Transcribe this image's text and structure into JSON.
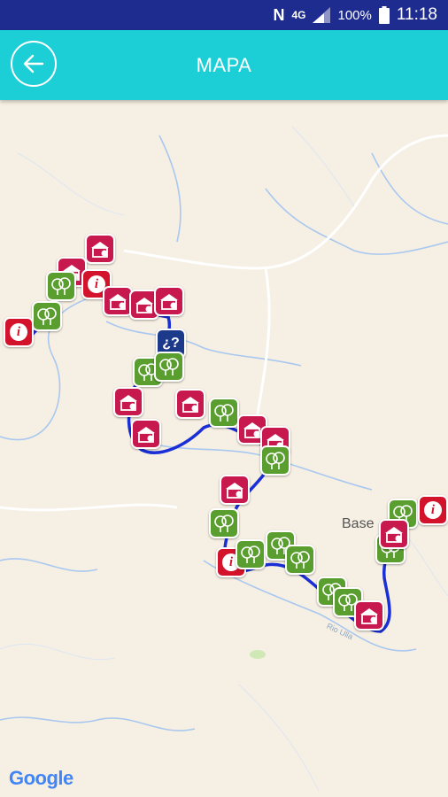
{
  "status_bar": {
    "network_label": "4G",
    "battery_percent": "100%",
    "time": "11:18"
  },
  "app_bar": {
    "title": "MAPA",
    "back_icon": "arrow-left-icon"
  },
  "map": {
    "place_label": "Base",
    "river_label": "Rio Ulla",
    "attribution": "Google",
    "markers": [
      {
        "type": "house",
        "icon": "house-icon"
      },
      {
        "type": "house",
        "icon": "house-icon"
      },
      {
        "type": "info",
        "icon": "info-icon"
      },
      {
        "type": "nature",
        "icon": "tree-icon"
      },
      {
        "type": "nature",
        "icon": "tree-icon"
      },
      {
        "type": "info",
        "icon": "info-icon"
      },
      {
        "type": "house",
        "icon": "house-icon"
      },
      {
        "type": "house",
        "icon": "house-icon"
      },
      {
        "type": "house",
        "icon": "house-icon"
      },
      {
        "type": "help",
        "icon": "question-icon"
      },
      {
        "type": "nature",
        "icon": "tree-icon"
      },
      {
        "type": "nature",
        "icon": "tree-icon"
      },
      {
        "type": "house",
        "icon": "house-icon"
      },
      {
        "type": "house",
        "icon": "house-icon"
      },
      {
        "type": "house",
        "icon": "house-icon"
      },
      {
        "type": "nature",
        "icon": "tree-icon"
      },
      {
        "type": "house",
        "icon": "house-icon"
      },
      {
        "type": "house",
        "icon": "house-icon"
      },
      {
        "type": "nature",
        "icon": "tree-icon"
      },
      {
        "type": "house",
        "icon": "house-icon"
      },
      {
        "type": "nature",
        "icon": "tree-icon"
      },
      {
        "type": "info",
        "icon": "info-icon"
      },
      {
        "type": "nature",
        "icon": "tree-icon"
      },
      {
        "type": "nature",
        "icon": "tree-icon"
      },
      {
        "type": "nature",
        "icon": "tree-icon"
      },
      {
        "type": "nature",
        "icon": "tree-icon"
      },
      {
        "type": "nature",
        "icon": "tree-icon"
      },
      {
        "type": "house",
        "icon": "house-icon"
      },
      {
        "type": "nature",
        "icon": "tree-icon"
      },
      {
        "type": "nature",
        "icon": "tree-icon"
      },
      {
        "type": "house",
        "icon": "house-icon"
      },
      {
        "type": "info",
        "icon": "info-icon"
      }
    ]
  },
  "colors": {
    "status_bar": "#1f2c8f",
    "app_bar": "#1ccfd6",
    "route": "#1a2fd6",
    "nature": "#5a9e2f",
    "house": "#c8194f",
    "info": "#d3122b",
    "help": "#1d3a8a"
  }
}
